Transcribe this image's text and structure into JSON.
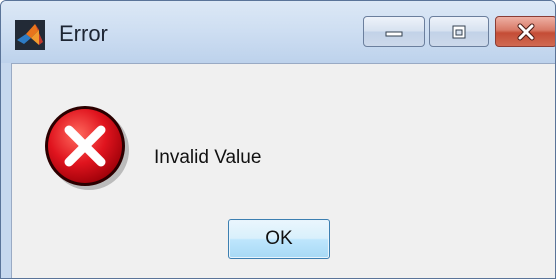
{
  "window": {
    "title": "Error",
    "controls": {
      "minimize_icon": "minimize-icon",
      "maximize_icon": "maximize-icon",
      "close_icon": "close-icon"
    }
  },
  "dialog": {
    "icon": "error-icon",
    "message": "Invalid Value",
    "ok_label": "OK"
  },
  "colors": {
    "error_red": "#e0141e",
    "close_button": "#c44d36",
    "button_blue": "#bee6fd"
  }
}
